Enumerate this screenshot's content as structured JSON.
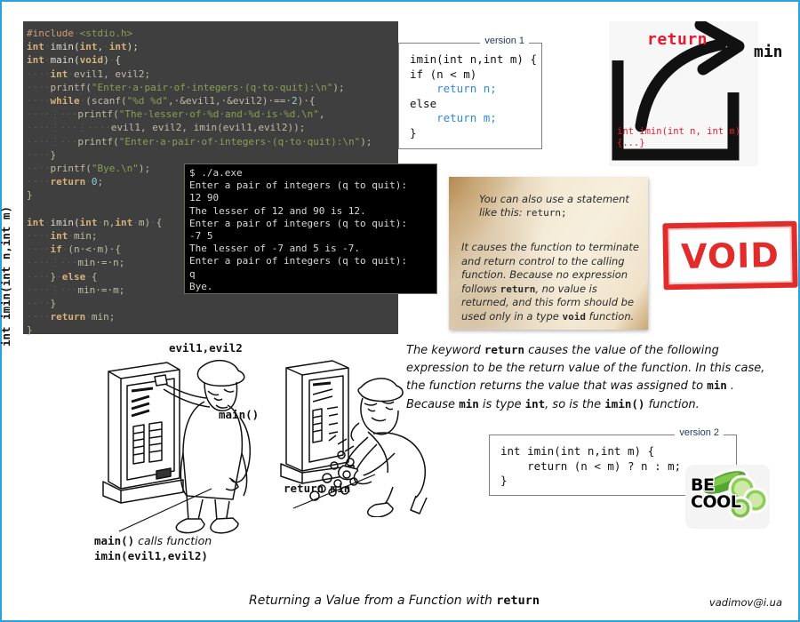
{
  "page": {
    "border_color": "#29a3dd",
    "footer_title_plain": "Returning a Value from a Function with ",
    "footer_title_mono": "return",
    "signature": "vadimov@i.ua"
  },
  "editor": {
    "background": "#3f3f3f",
    "lines": [
      "#include <stdio.h>",
      "int imin(int, int);",
      "int main(void) {",
      "    int evil1, evil2;",
      "    printf(\"Enter a pair of integers (q to quit):\\n\");",
      "    while (scanf(\"%d %d\", &evil1, &evil2) == 2) {",
      "        printf(\"The lesser of %d and %d is %d.\\n\",",
      "               evil1, evil2, imin(evil1,evil2));",
      "        printf(\"Enter a pair of integers (q to quit):\\n\");",
      "    }",
      "    printf(\"Bye.\\n\");",
      "    return 0;",
      "}",
      "",
      "int imin(int n,int m) {",
      "    int min;",
      "    if (n < m) {",
      "        min = n;",
      "    } else {",
      "        min = m;",
      "    }",
      "    return min;",
      "}"
    ]
  },
  "terminal": {
    "background": "#000000",
    "lines": [
      "$ ./a.exe",
      "Enter a pair of integers (q to quit):",
      "12 90",
      "The lesser of 12 and 90 is 12.",
      "Enter a pair of integers (q to quit):",
      "-7 5",
      "The lesser of -7 and 5 is -7.",
      "Enter a pair of integers (q to quit):",
      "q",
      "Bye."
    ]
  },
  "version1": {
    "legend": "version 1",
    "line1": "imin(int n,int m) {",
    "line2": "if (n < m)",
    "line3": "    return n;",
    "line4": "else",
    "line5": "    return m;",
    "line6": "}"
  },
  "version2": {
    "legend": "version 2",
    "line1": "int imin(int n,int m) {",
    "line2": "    return (n < m) ? n : m;",
    "line3": "}"
  },
  "arrow_figure": {
    "return_label": "return",
    "min_label": "min",
    "signature_line1": "int imin(int n, int m)",
    "signature_line2": "{...}",
    "return_color": "#e8192c"
  },
  "parchment": {
    "intro_a": "You can also use a statement like this: ",
    "intro_b": "return;",
    "body_1": "It causes the function to terminate and return control to the calling function. Because no expression follows ",
    "body_kw1": "return",
    "body_2": ", no value is returned, and this form should be used only in a type ",
    "body_kw2": "void",
    "body_3": " function."
  },
  "void_stamp": {
    "label": "VOID",
    "color": "#e01b1b"
  },
  "paragraph": {
    "p1": "The keyword ",
    "kw1": "return",
    "p2": " causes the value of the following expression to be the return value of the function. In this case, the function returns the value that was assigned to ",
    "kw2": "min",
    "p3": " . Because ",
    "kw3": "min",
    "p4": " is type ",
    "kw4": "int",
    "p5": ", so is the ",
    "kw5": "imin()",
    "p6": " function."
  },
  "becool": {
    "line1": "BE",
    "line2": "COOL"
  },
  "illustration_left": {
    "vertical_label": "int imin(int n,int m)",
    "top_label": "evil1,evil2",
    "right_label": "main()",
    "caption_1_mono": "main()",
    "caption_1_italic": " calls function",
    "caption_2_mono": "imin(evil1,evil2)"
  },
  "illustration_right": {
    "bottom_label": "return min"
  }
}
